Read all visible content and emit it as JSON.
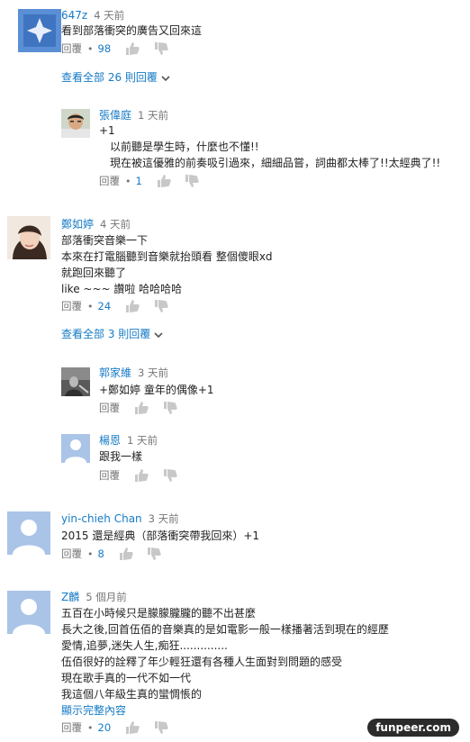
{
  "reply_label": "回覆",
  "comments": [
    {
      "author": "647z",
      "time": "4 天前",
      "lines": [
        "看到部落衝突的廣告又回來這"
      ],
      "likes": "98",
      "view_all": "查看全部 26 則回覆"
    },
    {
      "author": "張偉庭",
      "time": "1 天前",
      "lines": [
        "+1",
        "　以前聽是學生時，什麼也不懂!!",
        "　現在被這優雅的前奏吸引過來，細細品嘗，詞曲都太棒了!!太經典了!!"
      ],
      "likes": "1"
    },
    {
      "author": "鄭如婷",
      "time": "4 天前",
      "lines": [
        "部落衝突音樂一下",
        "本來在打電腦聽到音樂就抬頭看 整個傻眼xd",
        "就跑回來聽了",
        "like ~~~ 讚啦 哈哈哈哈"
      ],
      "likes": "24",
      "view_all": "查看全部 3 則回覆"
    },
    {
      "author": "郭家維",
      "time": "3 天前",
      "lines": [
        "+鄭如婷 童年的偶像+1"
      ]
    },
    {
      "author": "楊恩",
      "time": "1 天前",
      "lines": [
        "跟我一樣"
      ]
    },
    {
      "author": "yin-chieh Chan",
      "time": "3 天前",
      "lines": [
        "2015 還是經典（部落衝突帶我回來）+1"
      ],
      "likes": "8"
    },
    {
      "author": "Z麟",
      "time": "5 個月前",
      "lines": [
        "五百在小時候只是朦朦朧朧的聽不出甚麼",
        "長大之後,回首伍佰的音樂真的是如電影一般一樣播著活到現在的經歷",
        "愛情,追夢,迷失人生,痴狂..............",
        "伍佰很好的詮釋了年少輕狂還有各種人生面對到問題的感受",
        "現在歌手真的一代不如一代",
        "我這個八年級生真的蠻惆悵的"
      ],
      "show_more": "顯示完整內容",
      "likes": "20"
    }
  ],
  "watermark": "funpeer.com",
  "colors": {
    "link": "#167ac6",
    "meta": "#767676",
    "default_avatar_bg": "#aac4e8"
  }
}
